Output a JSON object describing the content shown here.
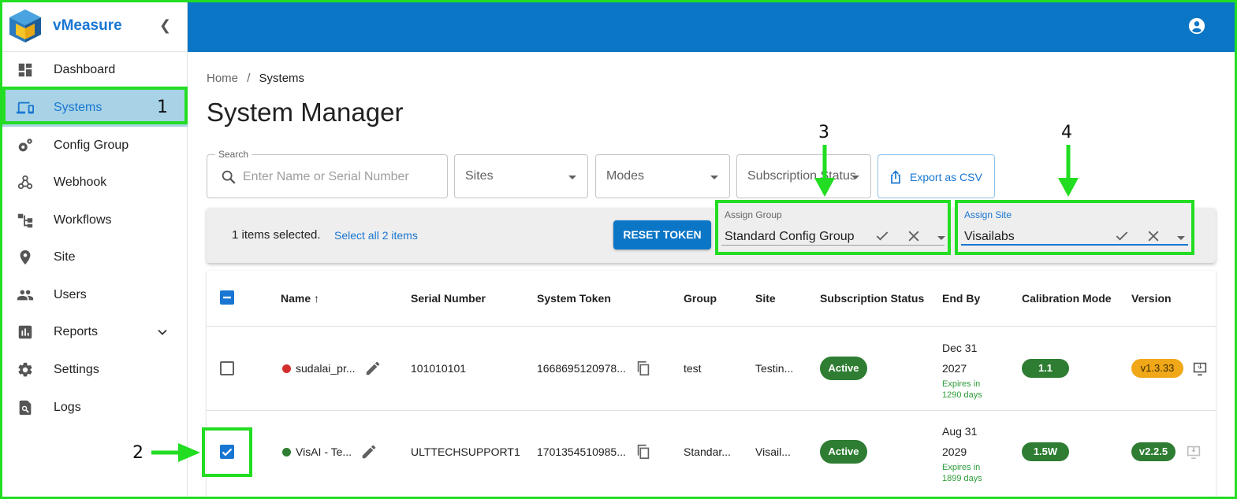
{
  "app": {
    "name": "vMeasure"
  },
  "sidebar": {
    "items": [
      {
        "label": "Dashboard",
        "icon": "dashboard-icon"
      },
      {
        "label": "Systems",
        "icon": "systems-icon",
        "badge": "1"
      },
      {
        "label": "Config Group",
        "icon": "config-group-icon"
      },
      {
        "label": "Webhook",
        "icon": "webhook-icon"
      },
      {
        "label": "Workflows",
        "icon": "workflows-icon"
      },
      {
        "label": "Site",
        "icon": "location-pin-icon"
      },
      {
        "label": "Users",
        "icon": "users-icon"
      },
      {
        "label": "Reports",
        "icon": "reports-icon"
      },
      {
        "label": "Settings",
        "icon": "gear-icon"
      },
      {
        "label": "Logs",
        "icon": "logs-icon"
      }
    ]
  },
  "breadcrumb": {
    "home": "Home",
    "sep": "/",
    "current": "Systems"
  },
  "page": {
    "title": "System Manager"
  },
  "filters": {
    "search_legend": "Search",
    "search_placeholder": "Enter Name or Serial Number",
    "sites": "Sites",
    "modes": "Modes",
    "subscription": "Subscription Status",
    "export": "Export as CSV"
  },
  "annotations": {
    "a1": "1",
    "a2": "2",
    "a3": "3",
    "a4": "4"
  },
  "selection": {
    "count_text": "1 items selected.",
    "select_all": "Select all 2 items",
    "reset": "RESET TOKEN"
  },
  "assign_group": {
    "label": "Assign Group",
    "value": "Standard Config Group"
  },
  "assign_site": {
    "label": "Assign Site",
    "value": "Visailabs"
  },
  "table": {
    "headers": {
      "name": "Name ↑",
      "serial": "Serial Number",
      "token": "System Token",
      "group": "Group",
      "site": "Site",
      "subscription": "Subscription Status",
      "endby": "End By",
      "calibration": "Calibration Mode",
      "version": "Version"
    },
    "rows": [
      {
        "name": "sudalai_pr...",
        "status_color": "#d32f2f",
        "serial": "101010101",
        "token": "1668695120978...",
        "group": "test",
        "site": "Testin...",
        "subscription": "Active",
        "end_date_1": "Dec 31",
        "end_date_2": "2027",
        "expires_1": "Expires in",
        "expires_2": "1290 days",
        "calibration": "1.1",
        "version": "v1.3.33",
        "version_color": "#f0a818"
      },
      {
        "name": "VisAI - Te...",
        "status_color": "#2e7d32",
        "serial": "ULTTECHSUPPORT1",
        "token": "1701354510985...",
        "group": "Standar...",
        "site": "Visail...",
        "subscription": "Active",
        "end_date_1": "Aug 31",
        "end_date_2": "2029",
        "expires_1": "Expires in",
        "expires_2": "1899 days",
        "calibration": "1.5W",
        "version": "v2.2.5",
        "version_color": "#2e7d32"
      }
    ]
  }
}
